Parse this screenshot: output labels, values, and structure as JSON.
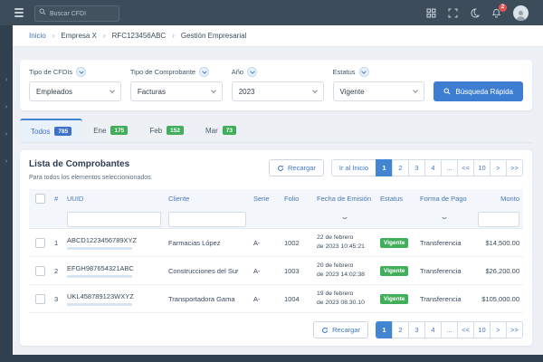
{
  "topbar": {
    "search_placeholder": "Buscar CFDI",
    "notification_count": "2"
  },
  "breadcrumb": {
    "separator": "›",
    "items": [
      "Inicio",
      "Empresa X",
      "RFC123456ABC",
      "Gestión Empresarial"
    ]
  },
  "sidebar": {
    "chevron": "›"
  },
  "filters": {
    "fields": [
      {
        "label": "Tipo de CFDIs",
        "value": "Empleados"
      },
      {
        "label": "Tipo de Comprobante",
        "value": "Facturas"
      },
      {
        "label": "Año",
        "value": "2023"
      },
      {
        "label": "Estatus",
        "value": "Vigente"
      }
    ],
    "search_button": "Búsqueda Rápida"
  },
  "tabs": [
    {
      "label": "Todos",
      "count": "785"
    },
    {
      "label": "Ene",
      "count": "175"
    },
    {
      "label": "Feb",
      "count": "152"
    },
    {
      "label": "Mar",
      "count": "73"
    }
  ],
  "list": {
    "title": "Lista de Comprobantes",
    "subtitle": "Para todos los elementos seleccionionados.",
    "reload_label": "Recargar",
    "go_first_label": "Ir al Inicio"
  },
  "pagination": {
    "active_page": "1",
    "pages": [
      "1",
      "2",
      "3",
      "4",
      "...",
      "<<",
      "10",
      ">",
      ">>"
    ]
  },
  "table": {
    "columns": [
      "#",
      "UUID",
      "Cliente",
      "Serie",
      "Folio",
      "Fecha de Emisión",
      "Estatus",
      "Forma de Pago",
      "Monto"
    ],
    "rows": [
      {
        "num": "1",
        "uuid": "ABCD1223456789XYZ",
        "cliente": "Farmacias López",
        "serie": "A-",
        "folio": "1002",
        "fecha1": "22 de febrero",
        "fecha2": "de 2023 10:45:21",
        "estatus": "Vigente",
        "forma_pago": "Transferencia",
        "monto": "$14,500.00"
      },
      {
        "num": "2",
        "uuid": "EFGH987654321ABC",
        "cliente": "Construcciones del Sur",
        "serie": "A-",
        "folio": "1003",
        "fecha1": "20 de febrero",
        "fecha2": "de 2023 14:02:38",
        "estatus": "Vigente",
        "forma_pago": "Transferencia",
        "monto": "$26,200.00"
      },
      {
        "num": "3",
        "uuid": "UKL458789123WXYZ",
        "cliente": "Transportadora Gama",
        "serie": "A-",
        "folio": "1004",
        "fecha1": "19 de febrero",
        "fecha2": "de 2023 08.30.10",
        "estatus": "Vigente",
        "forma_pago": "Transferencia",
        "monto": "$105,000.00"
      }
    ]
  },
  "colors": {
    "accent": "#3e7ed2",
    "active_page": "#4285d3",
    "green_badge": "#41ae5c",
    "red_badge": "#e25555",
    "topbar": "#3d4c5b",
    "sidebar": "#31404f"
  }
}
